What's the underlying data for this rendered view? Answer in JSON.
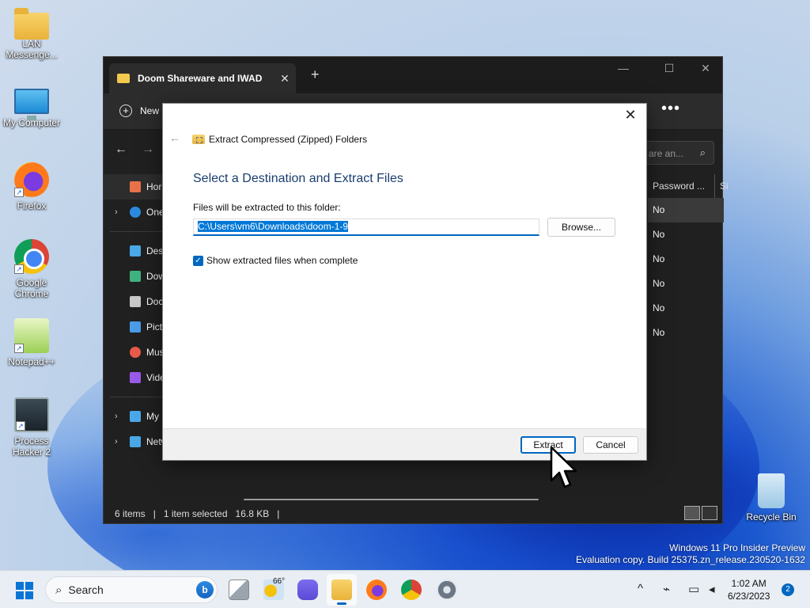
{
  "desktop": {
    "icons": [
      {
        "label": "LAN Messenge...",
        "icon": "folder-icon"
      },
      {
        "label": "My Computer",
        "icon": "monitor-icon"
      },
      {
        "label": "Firefox",
        "icon": "firefox-icon"
      },
      {
        "label": "Google Chrome",
        "icon": "chrome-icon"
      },
      {
        "label": "Notepad++",
        "icon": "notepadpp-icon"
      },
      {
        "label": "Process Hacker 2",
        "icon": "process-hacker-icon"
      },
      {
        "label": "Recycle Bin",
        "icon": "recycle-bin-icon"
      }
    ],
    "watermark": {
      "line1": "Windows 11 Pro Insider Preview",
      "line2": "Evaluation copy. Build 25375.zn_release.230520-1632"
    }
  },
  "explorer": {
    "tab_title": "Doom Shareware and IWAD",
    "tab_close": "✕",
    "new_tab": "+",
    "window_controls": {
      "minimize": "—",
      "maximize": "☐",
      "close": "✕"
    },
    "toolbar": {
      "new_label": "New",
      "more": "•••"
    },
    "nav": {
      "back": "←",
      "forward": "→"
    },
    "search_placeholder": "are an...",
    "sidebar": [
      {
        "label": "Hor",
        "icon": "home-icon",
        "chevron": "",
        "color": "#e8734a"
      },
      {
        "label": "One",
        "icon": "onedrive-icon",
        "chevron": "›",
        "color": "#2b8ae0"
      },
      {
        "label": "Desl",
        "icon": "desktop-icon",
        "chevron": "",
        "color": "#4aa8e8"
      },
      {
        "label": "Dow",
        "icon": "downloads-icon",
        "chevron": "",
        "color": "#3fb37f"
      },
      {
        "label": "Doc",
        "icon": "documents-icon",
        "chevron": "",
        "color": "#c8c8c8"
      },
      {
        "label": "Pict",
        "icon": "pictures-icon",
        "chevron": "",
        "color": "#4a9be8"
      },
      {
        "label": "Mus",
        "icon": "music-icon",
        "chevron": "",
        "color": "#e85a4a"
      },
      {
        "label": "Vide",
        "icon": "videos-icon",
        "chevron": "",
        "color": "#9a5ae8"
      },
      {
        "label": "My",
        "icon": "my-computer-icon",
        "chevron": "›",
        "color": "#4aa8e8"
      },
      {
        "label": "Network",
        "icon": "network-icon",
        "chevron": "›",
        "color": "#4aa8e8"
      }
    ],
    "columns": {
      "password": "Password ...",
      "size": "Si"
    },
    "password_values": [
      "No",
      "No",
      "No",
      "No",
      "No",
      "No"
    ],
    "status": {
      "items": "6 items",
      "selected": "1 item selected",
      "size": "16.8 KB",
      "sep": "|"
    }
  },
  "dialog": {
    "close": "✕",
    "back": "←",
    "header": "Extract Compressed (Zipped) Folders",
    "title": "Select a Destination and Extract Files",
    "folder_label": "Files will be extracted to this folder:",
    "path_value": "C:\\Users\\vm6\\Downloads\\doom-1-9",
    "browse_label": "Browse...",
    "checkbox_label": "Show extracted files when complete",
    "checkbox_checked": true,
    "extract_label": "Extract",
    "cancel_label": "Cancel"
  },
  "taskbar": {
    "search_label": "Search",
    "bing": "b",
    "weather_temp": "66°",
    "time": "1:02 AM",
    "date": "6/23/2023",
    "notification_count": "2",
    "tray_chevron": "^"
  }
}
